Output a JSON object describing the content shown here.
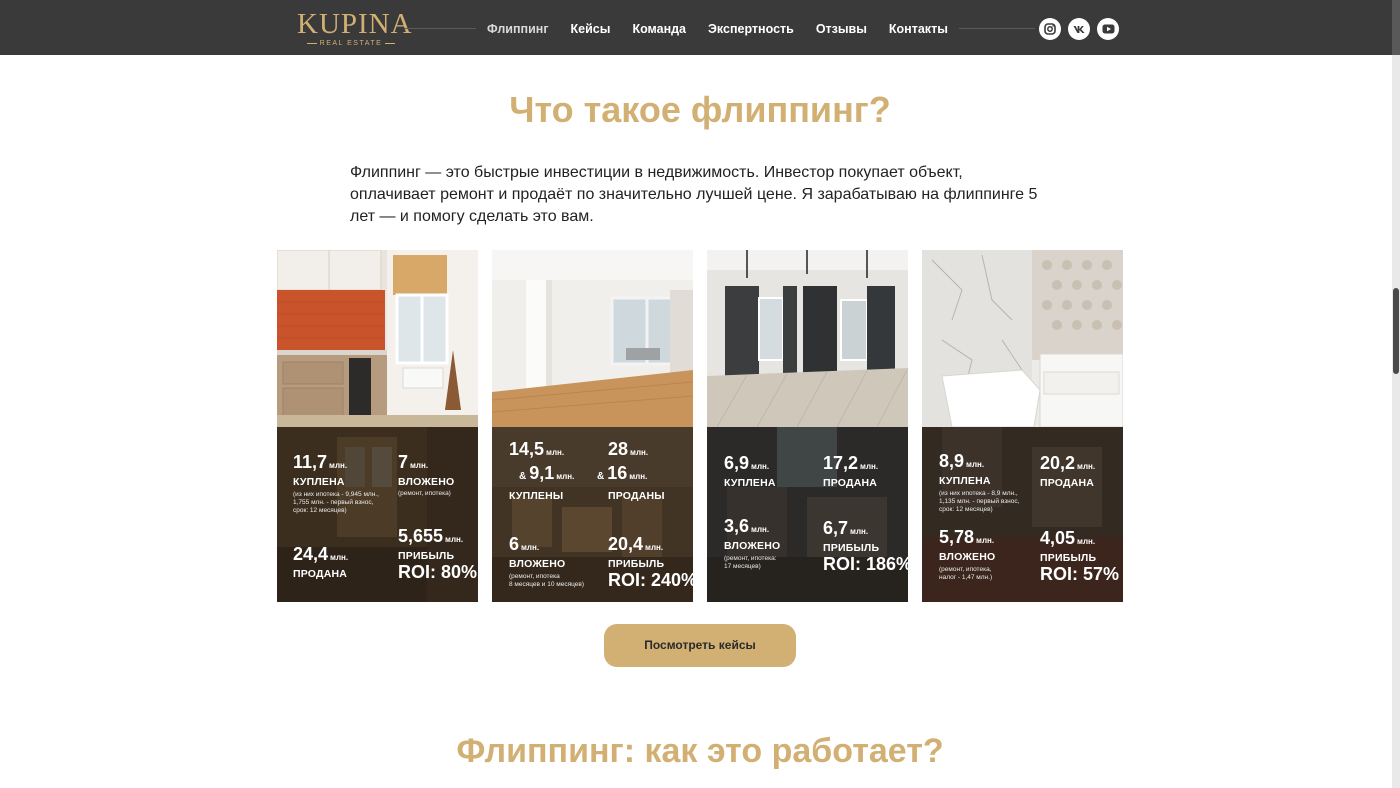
{
  "brand": {
    "logo_text": "KUPINA",
    "logo_sub": "REAL ESTATE"
  },
  "nav": [
    {
      "label": "Флиппинг",
      "active": true
    },
    {
      "label": "Кейсы"
    },
    {
      "label": "Команда"
    },
    {
      "label": "Экспертность"
    },
    {
      "label": "Отзывы"
    },
    {
      "label": "Контакты"
    }
  ],
  "social": [
    "instagram-icon",
    "vk-icon",
    "youtube-icon"
  ],
  "section1": {
    "title": "Что такое флиппинг?",
    "intro": "Флиппинг — это быстрые инвестиции в недвижимость. Инвестор покупает объект, оплачивает ремонт и продаёт по значительно лучшей цене. Я зарабатываю на флиппинге 5 лет — и помогу сделать это вам."
  },
  "unit": "млн.",
  "amp": "&",
  "cards": [
    {
      "bought": {
        "num": "11,7",
        "label": "КУПЛЕНА",
        "note": [
          "(из них ипотека - 9,945 млн.,",
          "1,755 млн. - первый взнос,",
          "срок:  12 месяцев)"
        ]
      },
      "invested": {
        "num": "7",
        "label": "ВЛОЖЕНО",
        "note": [
          "(ремонт, ипотека)"
        ]
      },
      "sold": {
        "num": "24,4",
        "label": "ПРОДАНА"
      },
      "profit": {
        "num": "5,655",
        "label": "ПРИБЫЛЬ",
        "roi": "ROI: 80%"
      }
    },
    {
      "bought": {
        "num": "14,5",
        "num2": "9,1",
        "label": "КУПЛЕНЫ"
      },
      "sold": {
        "num": "28",
        "num2": "16",
        "label": "ПРОДАНЫ"
      },
      "invested": {
        "num": "6",
        "label": "ВЛОЖЕНО",
        "note": [
          "(ремонт, ипотека",
          "8 месяцев и 10 месяцев)"
        ]
      },
      "profit": {
        "num": "20,4",
        "label": "ПРИБЫЛЬ",
        "roi": "ROI: 240%"
      }
    },
    {
      "bought": {
        "num": "6,9",
        "label": "КУПЛЕНА"
      },
      "sold": {
        "num": "17,2",
        "label": "ПРОДАНА"
      },
      "invested": {
        "num": "3,6",
        "label": "ВЛОЖЕНО",
        "note": [
          "(ремонт, ипотека:",
          "17 месяцев)"
        ]
      },
      "profit": {
        "num": "6,7",
        "label": "ПРИБЫЛЬ",
        "roi": "ROI: 186%"
      }
    },
    {
      "bought": {
        "num": "8,9",
        "label": "КУПЛЕНА",
        "note": [
          "(из них ипотека - 8,9 млн.,",
          "1,135 млн. - первый взнос,",
          "срок:  12 месяцев)"
        ]
      },
      "sold": {
        "num": "20,2",
        "label": "ПРОДАНА"
      },
      "invested": {
        "num": "5,78",
        "label": "ВЛОЖЕНО",
        "note": [
          "(ремонт, ипотека,",
          "налог - 1,47 млн.)"
        ]
      },
      "profit": {
        "num": "4,05",
        "label": "ПРИБЫЛЬ",
        "roi": "ROI: 57%"
      }
    }
  ],
  "cta": {
    "label": "Посмотреть кейсы"
  },
  "section2": {
    "title": "Флиппинг: как это работает?"
  },
  "colors": {
    "accent": "#d2b074",
    "header_bg": "#3a3a3a",
    "text": "#222222"
  }
}
